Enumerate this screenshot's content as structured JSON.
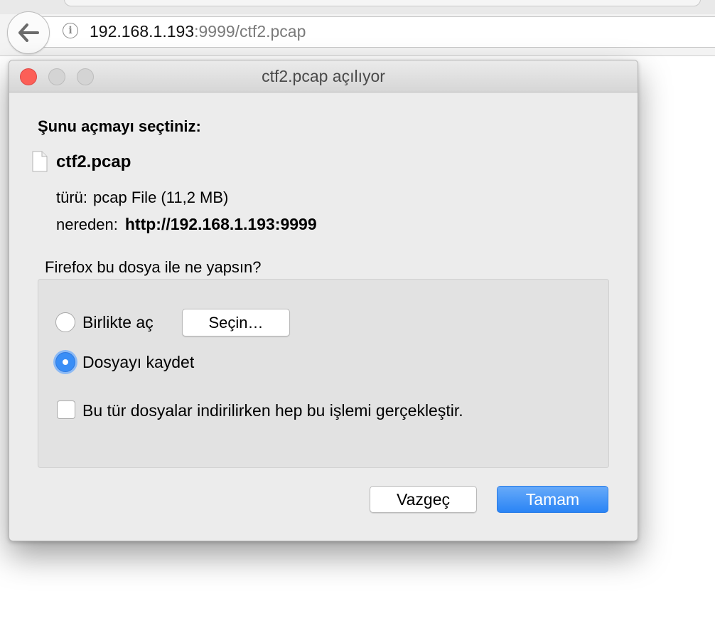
{
  "browser": {
    "url_host": "192.168.1.193",
    "url_rest": ":9999/ctf2.pcap",
    "back_icon": "back-arrow-icon",
    "info_icon": "info-icon"
  },
  "dialog": {
    "title": "ctf2.pcap açılıyor",
    "heading": "Şunu açmayı seçtiniz:",
    "file_name": "ctf2.pcap",
    "type_label": "türü:",
    "type_value": "pcap File (11,2 MB)",
    "from_label": "nereden:",
    "from_value": "http://192.168.1.193:9999",
    "question": "Firefox bu dosya ile ne yapsın?",
    "open_with_label": "Birlikte aç",
    "choose_button": "Seçin…",
    "save_label": "Dosyayı kaydet",
    "selected_option": "save",
    "remember_label": "Bu tür dosyalar indirilirken hep bu işlemi gerçekleştir.",
    "remember_checked": false,
    "cancel_button": "Vazgeç",
    "ok_button": "Tamam"
  },
  "colors": {
    "close_light": "#fc5f57",
    "accent": "#2a84f5"
  }
}
